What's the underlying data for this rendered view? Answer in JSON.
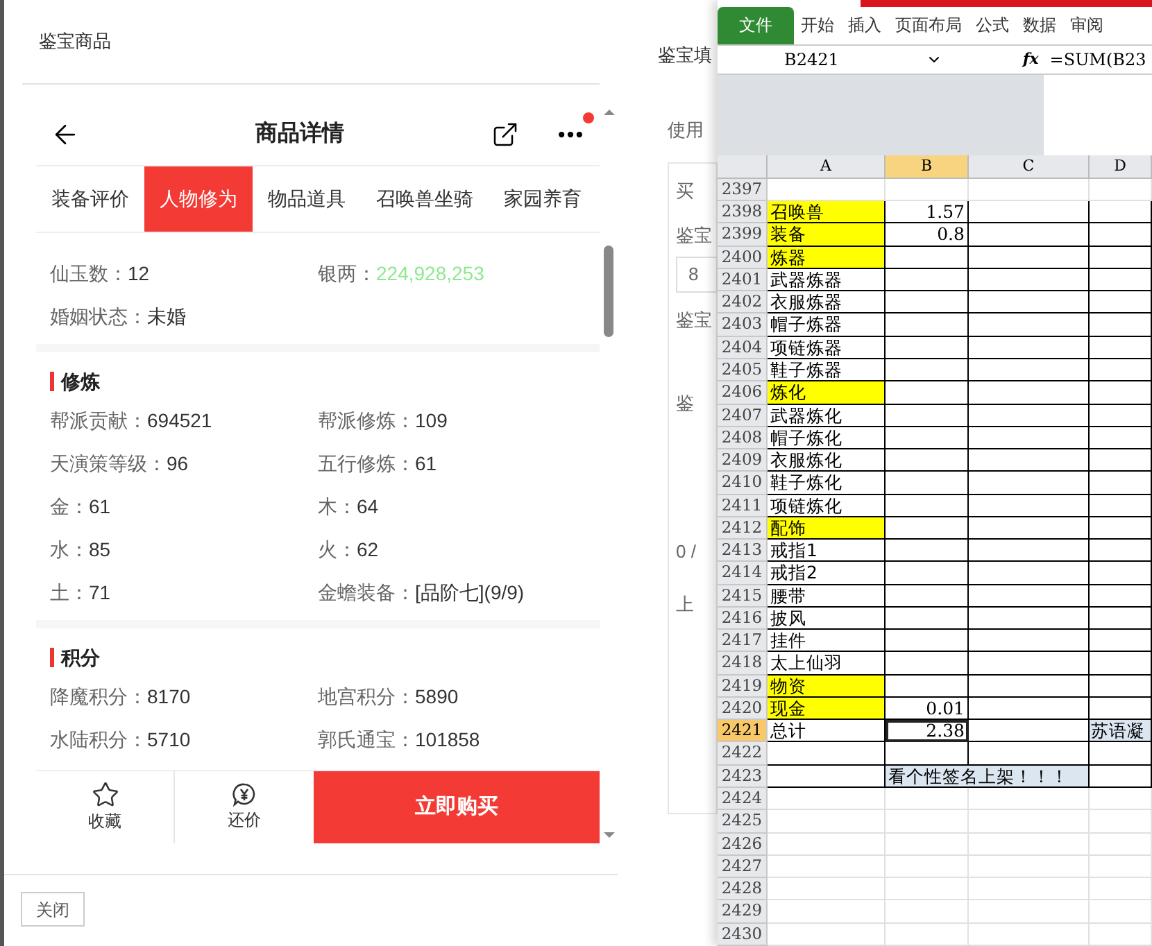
{
  "left_panel": {
    "title": "鉴宝商品",
    "close_button": "关闭"
  },
  "product": {
    "title": "商品详情",
    "notification_dot": true,
    "tabs": [
      {
        "label": "装备评价",
        "selected": false
      },
      {
        "label": "人物修为",
        "selected": true
      },
      {
        "label": "物品道具",
        "selected": false
      },
      {
        "label": "召唤兽坐骑",
        "selected": false
      },
      {
        "label": "家园养育",
        "selected": false
      }
    ],
    "sections": [
      {
        "rows": [
          [
            {
              "label": "仙玉数：",
              "value": "12",
              "kind": "plain"
            },
            {
              "label": "银两：",
              "value": "224,928,253",
              "kind": "money"
            }
          ],
          [
            {
              "label": "婚姻状态：",
              "value": "未婚",
              "kind": "plain"
            }
          ]
        ]
      },
      {
        "heading": "修炼",
        "rows": [
          [
            {
              "label": "帮派贡献：",
              "value": "694521",
              "kind": "plain"
            },
            {
              "label": "帮派修炼：",
              "value": "109",
              "kind": "plain"
            }
          ],
          [
            {
              "label": "天演策等级：",
              "value": "96",
              "kind": "plain"
            },
            {
              "label": "五行修炼：",
              "value": "61",
              "kind": "plain"
            }
          ],
          [
            {
              "label": "金：",
              "value": "61",
              "kind": "plain"
            },
            {
              "label": "木：",
              "value": "64",
              "kind": "plain"
            }
          ],
          [
            {
              "label": "水：",
              "value": "85",
              "kind": "plain"
            },
            {
              "label": "火：",
              "value": "62",
              "kind": "plain"
            }
          ],
          [
            {
              "label": "土：",
              "value": "71",
              "kind": "plain"
            },
            {
              "label": "金蟾装备：",
              "value": "[品阶七](9/9)",
              "kind": "plain"
            }
          ]
        ]
      },
      {
        "heading": "积分",
        "rows": [
          [
            {
              "label": "降魔积分：",
              "value": "8170",
              "kind": "plain"
            },
            {
              "label": "地宫积分：",
              "value": "5890",
              "kind": "plain"
            }
          ],
          [
            {
              "label": "水陆积分：",
              "value": "5710",
              "kind": "plain"
            },
            {
              "label": "郭氏通宝：",
              "value": "101858",
              "kind": "plain"
            }
          ]
        ]
      }
    ],
    "actions": [
      {
        "label": "收藏",
        "kind": "favorite"
      },
      {
        "label": "还价",
        "kind": "bargain"
      },
      {
        "label": "立即购买",
        "kind": "buy"
      }
    ]
  },
  "middle_panel": {
    "title": "鉴宝填",
    "fragments": [
      "使用",
      "买",
      "鉴宝",
      "8",
      "鉴宝",
      "鉴",
      "0 /",
      "上"
    ]
  },
  "spreadsheet": {
    "ribbon_tabs": [
      {
        "label": "文件",
        "kind": "file"
      },
      {
        "label": "开始",
        "kind": "tab"
      },
      {
        "label": "插入",
        "kind": "tab"
      },
      {
        "label": "页面布局",
        "kind": "tab"
      },
      {
        "label": "公式",
        "kind": "tab"
      },
      {
        "label": "数据",
        "kind": "tab"
      },
      {
        "label": "审阅",
        "kind": "tab"
      }
    ],
    "name_box": "B2421",
    "function_label": "fx",
    "formula": "=SUM(B23",
    "columns": [
      {
        "label": "A",
        "selected": false
      },
      {
        "label": "B",
        "selected": true
      },
      {
        "label": "C",
        "selected": false
      },
      {
        "label": "D",
        "selected": false
      }
    ],
    "rows": [
      {
        "number": "2397",
        "selected": false,
        "highlighted": false,
        "bordered": false
      },
      {
        "number": "2398",
        "selected": false,
        "a": "召唤兽",
        "highlighted": true,
        "b": "1.57",
        "bordered": true
      },
      {
        "number": "2399",
        "selected": false,
        "a": "装备",
        "highlighted": true,
        "b": "0.8",
        "bordered": true
      },
      {
        "number": "2400",
        "selected": false,
        "a": "炼器",
        "highlighted": true,
        "bordered": true
      },
      {
        "number": "2401",
        "selected": false,
        "a": "武器炼器",
        "highlighted": false,
        "bordered": true
      },
      {
        "number": "2402",
        "selected": false,
        "a": "衣服炼器",
        "highlighted": false,
        "bordered": true
      },
      {
        "number": "2403",
        "selected": false,
        "a": "帽子炼器",
        "highlighted": false,
        "bordered": true
      },
      {
        "number": "2404",
        "selected": false,
        "a": "项链炼器",
        "highlighted": false,
        "bordered": true
      },
      {
        "number": "2405",
        "selected": false,
        "a": "鞋子炼器",
        "highlighted": false,
        "bordered": true
      },
      {
        "number": "2406",
        "selected": false,
        "a": "炼化",
        "highlighted": true,
        "bordered": true
      },
      {
        "number": "2407",
        "selected": false,
        "a": "武器炼化",
        "highlighted": false,
        "bordered": true
      },
      {
        "number": "2408",
        "selected": false,
        "a": "帽子炼化",
        "highlighted": false,
        "bordered": true
      },
      {
        "number": "2409",
        "selected": false,
        "a": "衣服炼化",
        "highlighted": false,
        "bordered": true
      },
      {
        "number": "2410",
        "selected": false,
        "a": "鞋子炼化",
        "highlighted": false,
        "bordered": true
      },
      {
        "number": "2411",
        "selected": false,
        "a": "项链炼化",
        "highlighted": false,
        "bordered": true
      },
      {
        "number": "2412",
        "selected": false,
        "a": "配饰",
        "highlighted": true,
        "bordered": true
      },
      {
        "number": "2413",
        "selected": false,
        "a": "戒指1",
        "highlighted": false,
        "bordered": true
      },
      {
        "number": "2414",
        "selected": false,
        "a": "戒指2",
        "highlighted": false,
        "bordered": true
      },
      {
        "number": "2415",
        "selected": false,
        "a": "腰带",
        "highlighted": false,
        "bordered": true
      },
      {
        "number": "2416",
        "selected": false,
        "a": "披风",
        "highlighted": false,
        "bordered": true
      },
      {
        "number": "2417",
        "selected": false,
        "a": "挂件",
        "highlighted": false,
        "bordered": true
      },
      {
        "number": "2418",
        "selected": false,
        "a": "太上仙羽",
        "highlighted": false,
        "bordered": true
      },
      {
        "number": "2419",
        "selected": false,
        "a": "物资",
        "highlighted": true,
        "bordered": true
      },
      {
        "number": "2420",
        "selected": false,
        "a": "现金",
        "highlighted": true,
        "b": "0.01",
        "bordered": true
      },
      {
        "number": "2421",
        "selected": true,
        "a": "总计",
        "highlighted": false,
        "b": "2.38",
        "d": "苏语凝",
        "bordered": true
      },
      {
        "number": "2422",
        "selected": false,
        "highlighted": false,
        "bordered": true
      },
      {
        "number": "2423",
        "selected": false,
        "highlighted": false,
        "merged_bc": "看个性签名上架！！！",
        "bordered": true
      },
      {
        "number": "2424",
        "selected": false,
        "highlighted": false,
        "bordered": false
      },
      {
        "number": "2425",
        "selected": false,
        "highlighted": false,
        "bordered": false
      },
      {
        "number": "2426",
        "selected": false,
        "highlighted": false,
        "bordered": false
      },
      {
        "number": "2427",
        "selected": false,
        "highlighted": false,
        "bordered": false
      },
      {
        "number": "2428",
        "selected": false,
        "highlighted": false,
        "bordered": false
      },
      {
        "number": "2429",
        "selected": false,
        "highlighted": false,
        "bordered": false
      },
      {
        "number": "2430",
        "selected": false,
        "highlighted": false,
        "bordered": false
      }
    ]
  }
}
